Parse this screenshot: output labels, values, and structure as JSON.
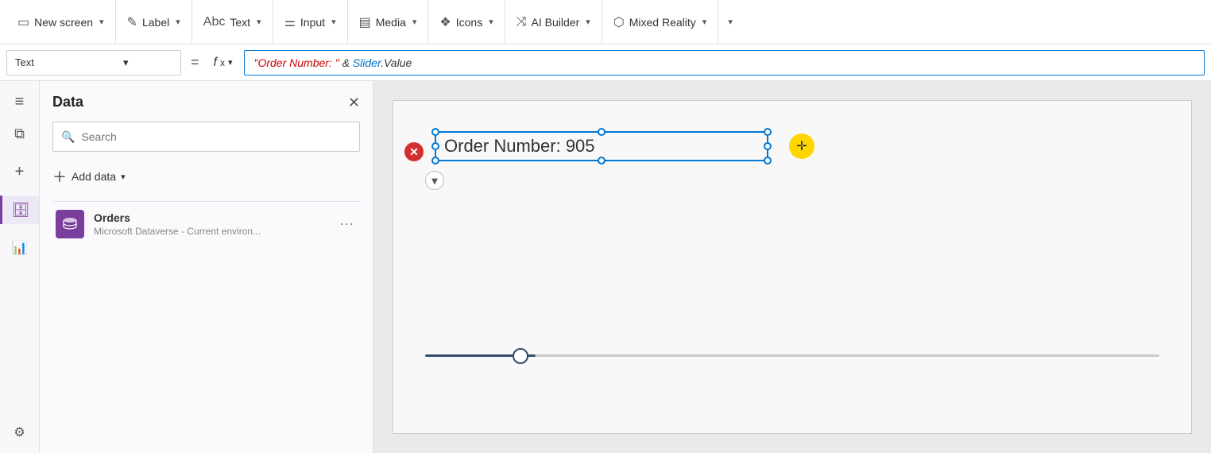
{
  "toolbar": {
    "new_screen_label": "New screen",
    "label_label": "Label",
    "text_label": "Text",
    "input_label": "Input",
    "media_label": "Media",
    "icons_label": "Icons",
    "ai_builder_label": "AI Builder",
    "mixed_reality_label": "Mixed Reality"
  },
  "formula_bar": {
    "property": "Text",
    "equals": "=",
    "fx_label": "fx",
    "formula_display": "\"Order Number: \" & Slider.Value"
  },
  "data_panel": {
    "title": "Data",
    "search_placeholder": "Search",
    "add_data_label": "Add data",
    "sources": [
      {
        "name": "Orders",
        "description": "Microsoft Dataverse - Current environ...",
        "icon": "database"
      }
    ]
  },
  "canvas": {
    "text_element": "Order Number: 905",
    "slider_value": 905
  },
  "sidebar_icons": [
    {
      "name": "hamburger-menu",
      "symbol": "≡",
      "active": false
    },
    {
      "name": "layers-icon",
      "symbol": "⧉",
      "active": false
    },
    {
      "name": "add-icon",
      "symbol": "+",
      "active": false
    },
    {
      "name": "database-icon",
      "symbol": "🗄",
      "active": true
    },
    {
      "name": "chart-icon",
      "symbol": "📊",
      "active": false
    },
    {
      "name": "settings-icon",
      "symbol": "⚙",
      "active": false
    }
  ]
}
